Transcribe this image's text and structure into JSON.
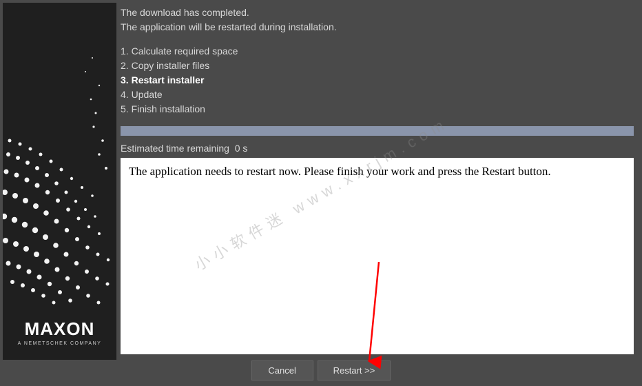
{
  "header": {
    "line1": "The download has completed.",
    "line2": "The application will be restarted during installation."
  },
  "steps": [
    {
      "num": "1.",
      "label": "Calculate required space",
      "current": false
    },
    {
      "num": "2.",
      "label": "Copy installer files",
      "current": false
    },
    {
      "num": "3.",
      "label": "Restart installer",
      "current": true
    },
    {
      "num": "4.",
      "label": "Update",
      "current": false
    },
    {
      "num": "5.",
      "label": "Finish installation",
      "current": false
    }
  ],
  "progress": {
    "time_label": "Estimated time remaining",
    "time_value": "0 s",
    "percent": 100
  },
  "message": "The application needs to restart now. Please finish your work and press the Restart button.",
  "buttons": {
    "cancel": "Cancel",
    "restart": "Restart >>"
  },
  "brand": {
    "name": "MAXON",
    "tagline": "A NEMETSCHEK COMPANY"
  },
  "watermark": "小小软件迷  www.xxrjm.com"
}
